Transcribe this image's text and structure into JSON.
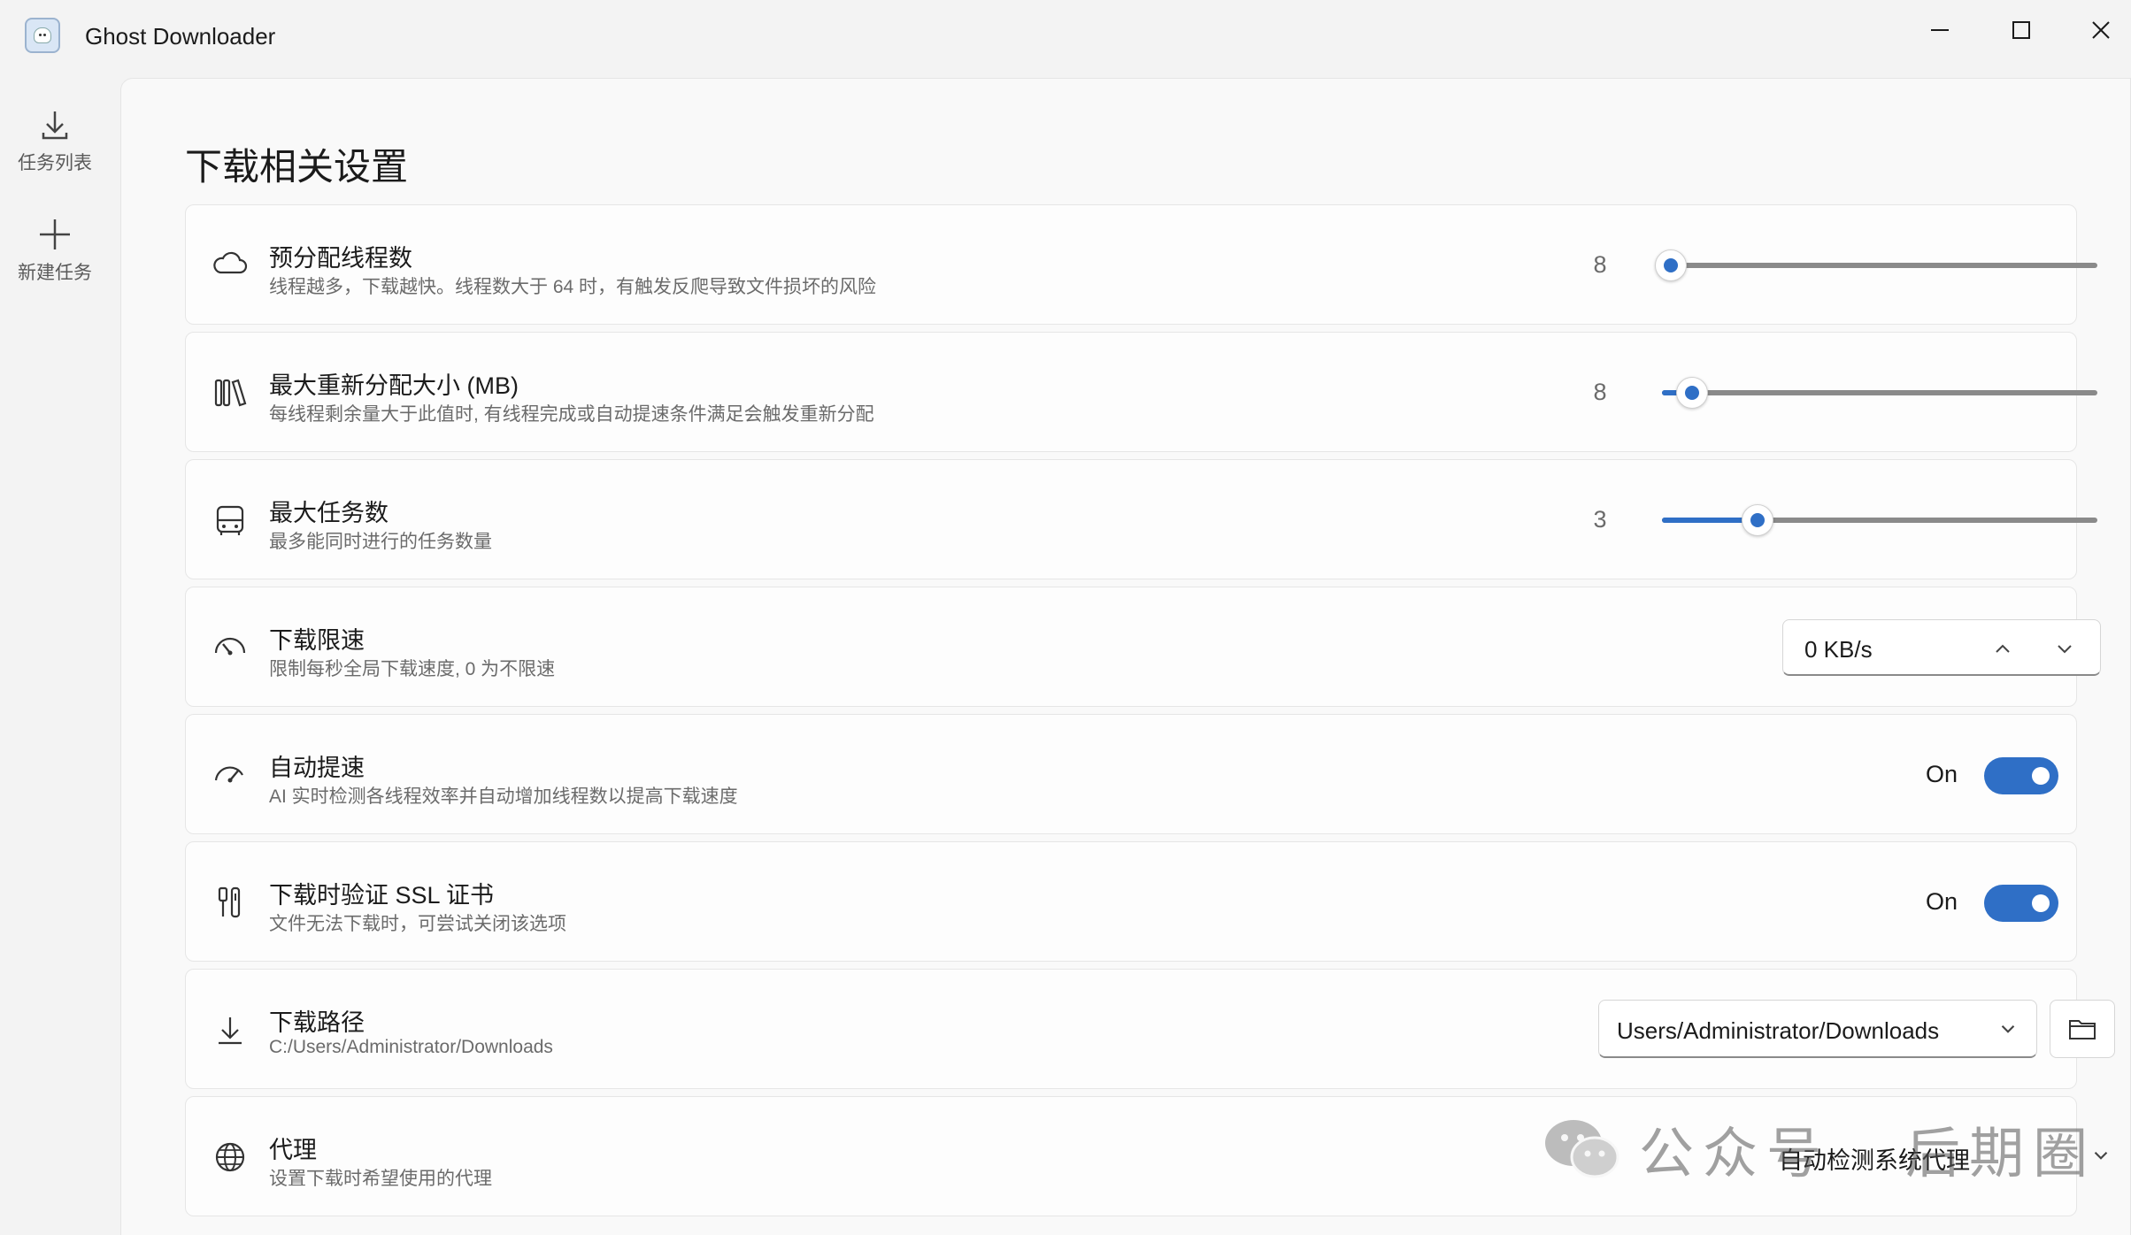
{
  "window": {
    "title": "Ghost Downloader",
    "controls": [
      "minimize-icon",
      "maximize-icon",
      "close-icon"
    ]
  },
  "sidebar": {
    "items": [
      {
        "label": "任务列表",
        "icon": "download-icon"
      },
      {
        "label": "新建任务",
        "icon": "plus-icon"
      }
    ]
  },
  "page": {
    "title": "下载相关设置"
  },
  "settings": {
    "pre_threads": {
      "title": "预分配线程数",
      "desc": "线程越多，下载越快。线程数大于 64 时，有触发反爬导致文件损坏的风险",
      "value": "8",
      "level": 0.02,
      "icon": "cloud-icon"
    },
    "max_realloc": {
      "title": "最大重新分配大小 (MB)",
      "desc": "每线程剩余量大于此值时, 有线程完成或自动提速条件满足会触发重新分配",
      "value": "8",
      "level": 0.07,
      "icon": "library-icon"
    },
    "max_tasks": {
      "title": "最大任务数",
      "desc": "最多能同时进行的任务数量",
      "value": "3",
      "level": 0.22,
      "icon": "bus-icon"
    },
    "speed_limit": {
      "title": "下载限速",
      "desc": "限制每秒全局下载速度, 0 为不限速",
      "value": "0 KB/s",
      "icon": "speedometer-icon"
    },
    "auto_speedup": {
      "title": "自动提速",
      "desc": "AI 实时检测各线程效率并自动增加线程数以提高下载速度",
      "state": "On",
      "icon": "speed-up-icon"
    },
    "ssl_verify": {
      "title": "下载时验证 SSL 证书",
      "desc": "文件无法下载时，可尝试关闭该选项",
      "state": "On",
      "icon": "certificate-icon"
    },
    "download_path": {
      "title": "下载路径",
      "desc": "C:/Users/Administrator/Downloads",
      "value": "Users/Administrator/Downloads",
      "icon": "download-icon"
    },
    "proxy": {
      "title": "代理",
      "desc": "设置下载时希望使用的代理",
      "value": "自动检测系统代理",
      "icon": "globe-icon"
    }
  },
  "watermark": {
    "text": "公众号 · 后期圈",
    "icon": "wechat-icon"
  },
  "colors": {
    "accent": "#2f6fc6",
    "background": "#f3f3f3",
    "card": "#fdfdfd"
  }
}
